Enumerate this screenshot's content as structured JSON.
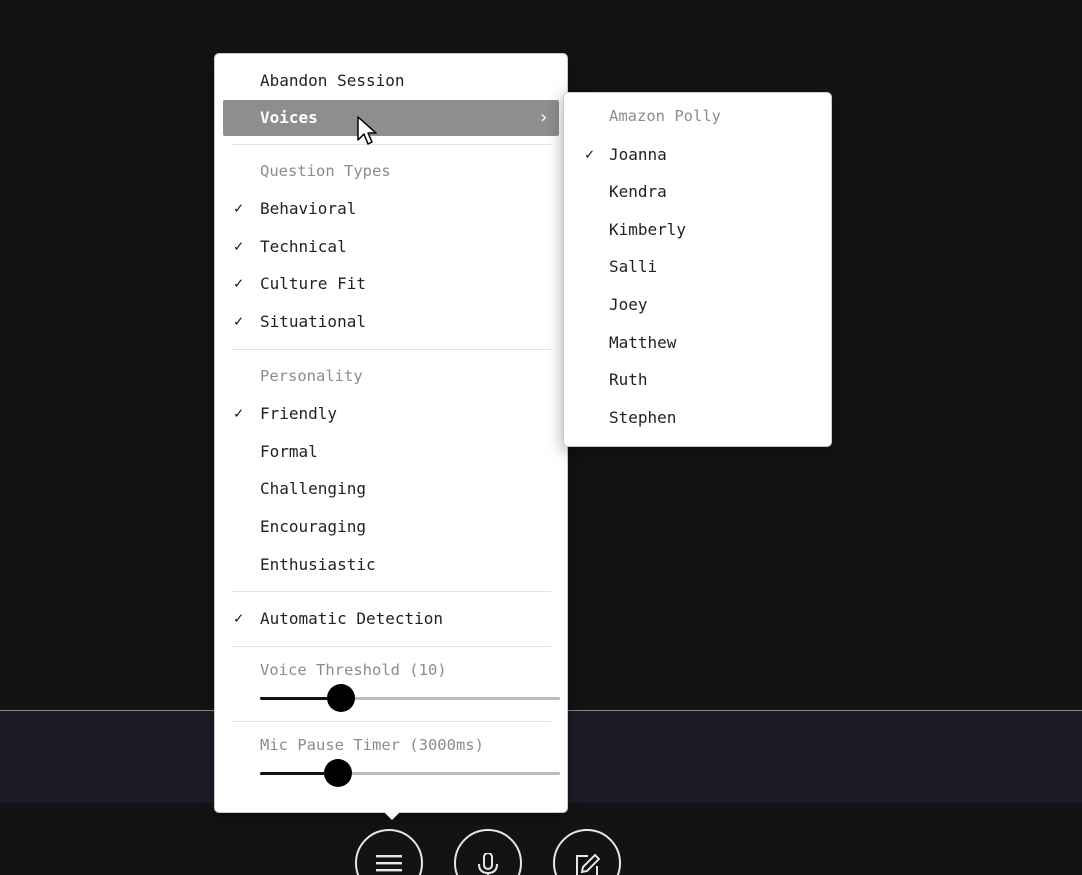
{
  "menu": {
    "abandon_label": "Abandon Session",
    "voices_label": "Voices",
    "question_types_header": "Question Types",
    "question_types": [
      {
        "label": "Behavioral",
        "checked": true
      },
      {
        "label": "Technical",
        "checked": true
      },
      {
        "label": "Culture Fit",
        "checked": true
      },
      {
        "label": "Situational",
        "checked": true
      }
    ],
    "personality_header": "Personality",
    "personality": [
      {
        "label": "Friendly",
        "checked": true
      },
      {
        "label": "Formal",
        "checked": false
      },
      {
        "label": "Challenging",
        "checked": false
      },
      {
        "label": "Encouraging",
        "checked": false
      },
      {
        "label": "Enthusiastic",
        "checked": false
      }
    ],
    "auto_detection_label": "Automatic Detection",
    "voice_threshold_label": "Voice Threshold (10)",
    "voice_threshold_fraction": 0.27,
    "mic_pause_label": "Mic Pause Timer (3000ms)",
    "mic_pause_fraction": 0.26
  },
  "voices_submenu": {
    "header": "Amazon Polly",
    "voices": [
      {
        "label": "Joanna",
        "checked": true
      },
      {
        "label": "Kendra",
        "checked": false
      },
      {
        "label": "Kimberly",
        "checked": false
      },
      {
        "label": "Salli",
        "checked": false
      },
      {
        "label": "Joey",
        "checked": false
      },
      {
        "label": "Matthew",
        "checked": false
      },
      {
        "label": "Ruth",
        "checked": false
      },
      {
        "label": "Stephen",
        "checked": false
      }
    ]
  },
  "glyphs": {
    "check": "✓",
    "chevron": "›"
  },
  "icons": {
    "menu_button": "hamburger-icon",
    "mic_button": "microphone-icon",
    "edit_button": "edit-icon"
  }
}
